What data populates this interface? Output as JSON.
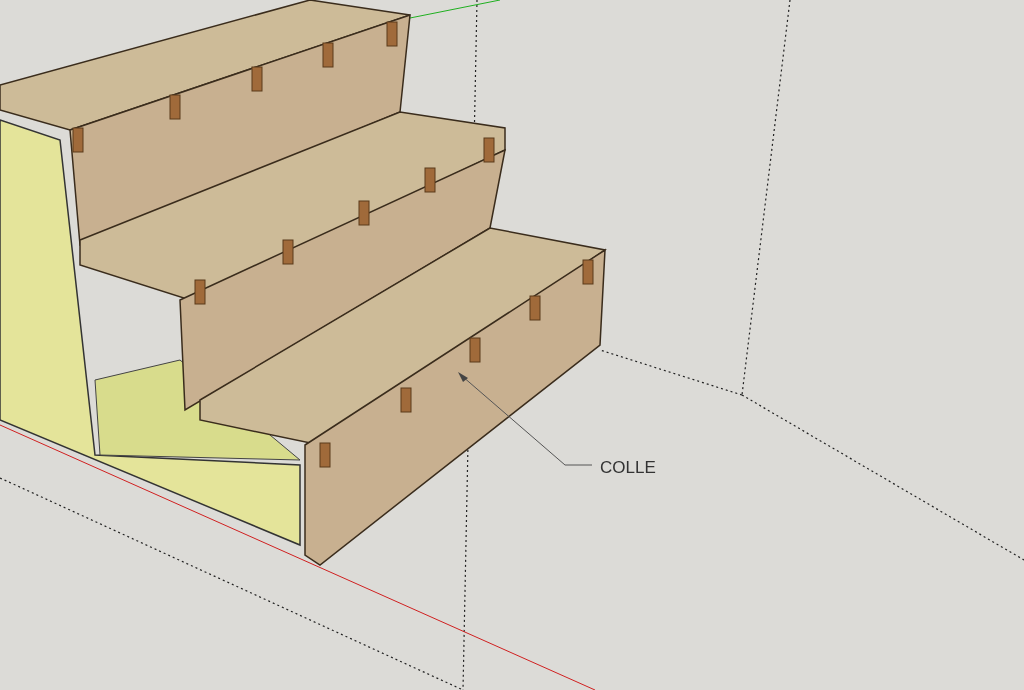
{
  "viewport": {
    "annotation": {
      "text": "COLLE"
    }
  }
}
